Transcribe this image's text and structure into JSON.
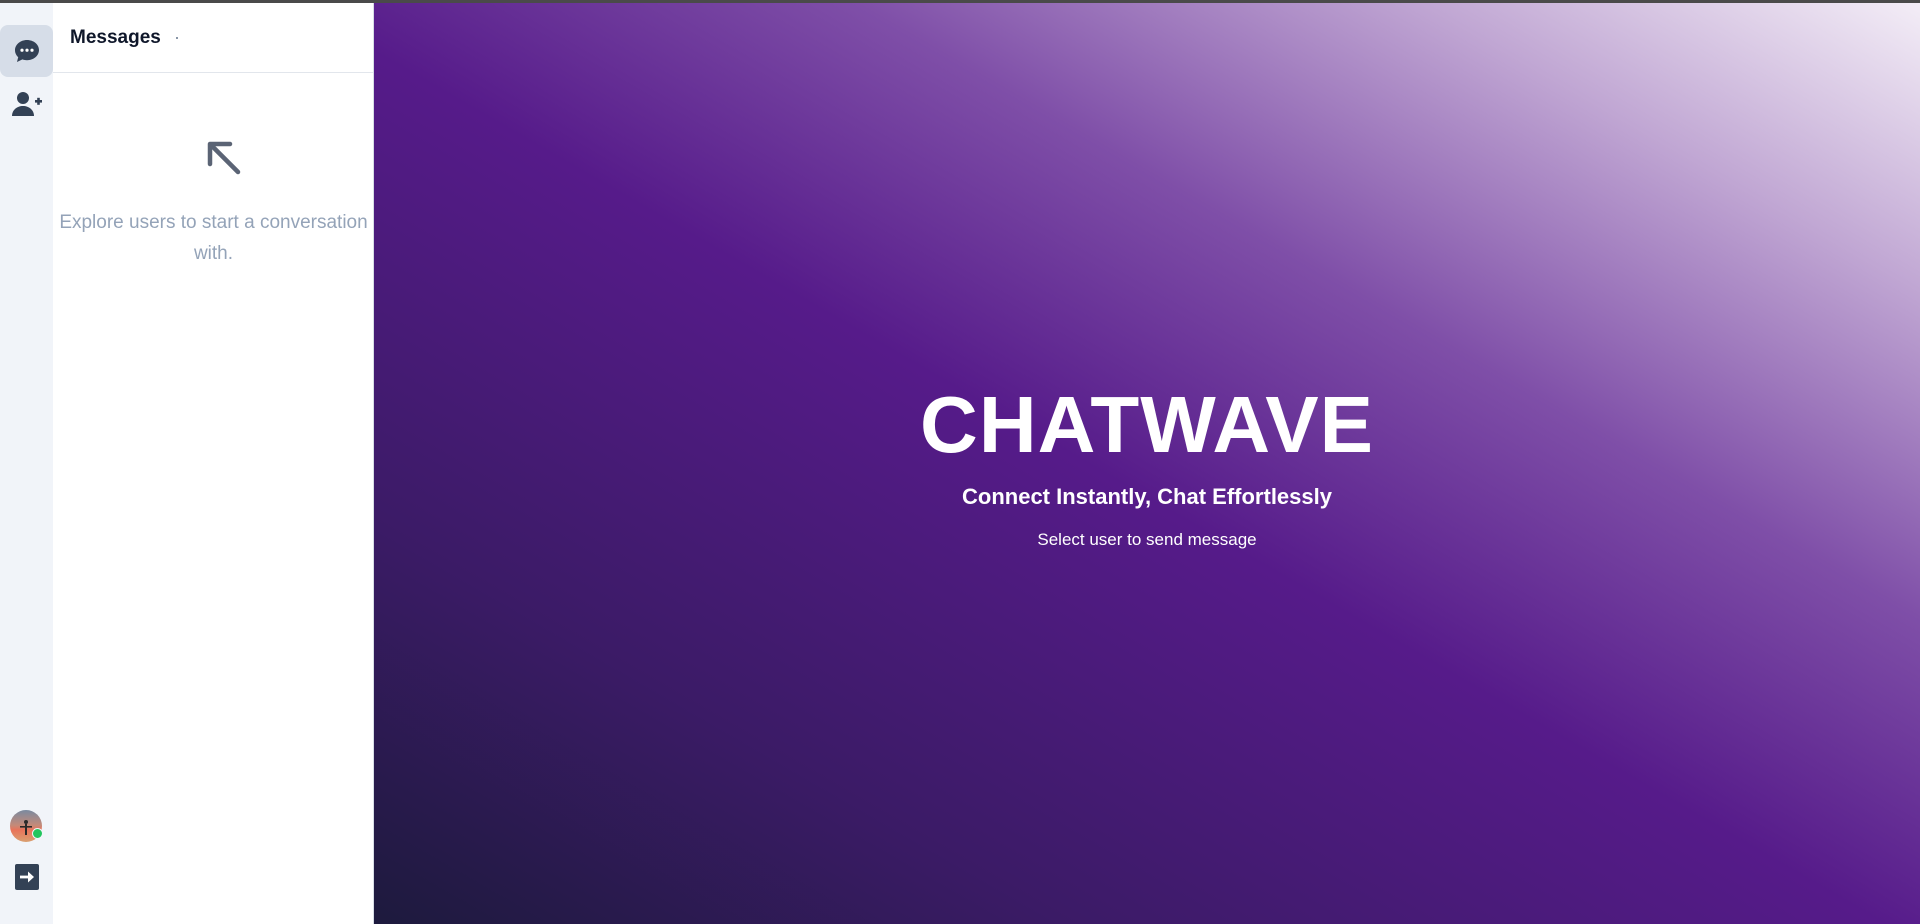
{
  "sidebar": {
    "nav": [
      {
        "name": "chat-bubble-icon",
        "active": true
      },
      {
        "name": "add-user-icon",
        "active": false
      }
    ],
    "profile": {
      "icon": "avatar",
      "status_color": "#22c55e"
    },
    "logout_icon": "logout-icon"
  },
  "messages_panel": {
    "title": "Messages",
    "empty_icon": "arrow-up-left-icon",
    "empty_text": "Explore users to start a conversation with."
  },
  "hero": {
    "title": "CHATWAVE",
    "tagline": "Connect Instantly, Chat Effortlessly",
    "hint": "Select user to send message"
  },
  "colors": {
    "rail_bg": "#f1f4f9",
    "rail_active": "#d6dde8",
    "icon": "#334155",
    "muted_text": "#94a3b8",
    "hero_dark": "#1d1a3d",
    "hero_purple": "#561b8a",
    "hero_light": "#f4eef7"
  }
}
